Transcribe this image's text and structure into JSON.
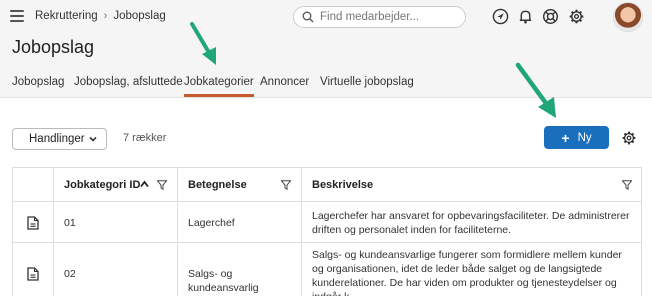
{
  "topbar": {
    "breadcrumb": [
      "Rekruttering",
      "Jobopslag"
    ],
    "breadcrumb_sep": "›",
    "search_placeholder": "Find medarbejder..."
  },
  "page": {
    "title": "Jobopslag"
  },
  "tabs": [
    {
      "label": "Jobopslag",
      "active": false
    },
    {
      "label": "Jobopslag, afsluttede",
      "active": false
    },
    {
      "label": "Jobkategorier",
      "active": true
    },
    {
      "label": "Annoncer",
      "active": false
    },
    {
      "label": "Virtuelle jobopslag",
      "active": false
    }
  ],
  "toolbar": {
    "actions_label": "Handlinger",
    "row_count": "7 rækker",
    "new_label": "Ny"
  },
  "table": {
    "columns": [
      "Jobkategori ID",
      "Betegnelse",
      "Beskrivelse"
    ],
    "rows": [
      {
        "id": "01",
        "name": "Lagerchef",
        "description": "Lagerchefer har ansvaret for opbevaringsfaciliteter. De administrerer driften og personalet inden for faciliteterne."
      },
      {
        "id": "02",
        "name": "Salgs- og kundeansvarlig",
        "description": "Salgs- og kundeansvarlige fungerer som formidlere mellem kunder og organisationen, idet de leder både salget og de langsigtede kunderelationer. De har viden om produkter og tjenesteydelser og indgår k"
      }
    ]
  },
  "colors": {
    "accent": "#1a6fbd",
    "active_tab": "#c65a2a",
    "annotation_arrow": "#21a67a"
  }
}
